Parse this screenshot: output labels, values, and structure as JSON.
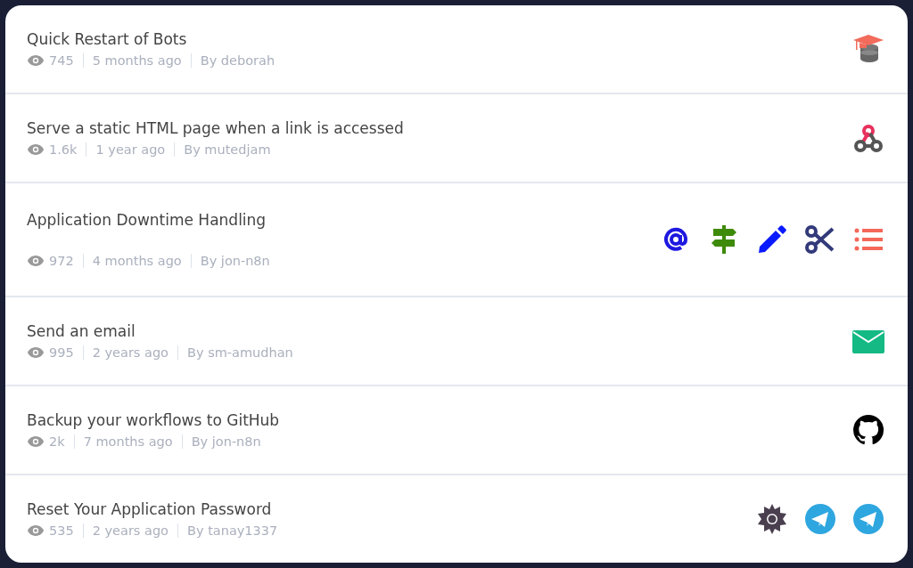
{
  "workflows": [
    {
      "title": "Quick Restart of Bots",
      "views": "745",
      "age": "5 months ago",
      "author": "By deborah",
      "icons": [
        {
          "kind": "school-database"
        }
      ]
    },
    {
      "title": "Serve a static HTML page when a link is accessed",
      "views": "1.6k",
      "age": "1 year ago",
      "author": "By mutedjam",
      "icons": [
        {
          "kind": "webhook"
        }
      ]
    },
    {
      "title": "Application Downtime Handling",
      "views": "972",
      "age": "4 months ago",
      "author": "By jon-n8n",
      "icons": [
        {
          "kind": "at"
        },
        {
          "kind": "signpost"
        },
        {
          "kind": "pencil"
        },
        {
          "kind": "scissors"
        },
        {
          "kind": "list"
        }
      ]
    },
    {
      "title": "Send an email",
      "views": "995",
      "age": "2 years ago",
      "author": "By sm-amudhan",
      "icons": [
        {
          "kind": "email"
        }
      ]
    },
    {
      "title": "Backup your workflows to GitHub",
      "views": "2k",
      "age": "7 months ago",
      "author": "By jon-n8n",
      "icons": [
        {
          "kind": "github"
        }
      ]
    },
    {
      "title": "Reset Your Application Password",
      "views": "535",
      "age": "2 years ago",
      "author": "By tanay1337",
      "icons": [
        {
          "kind": "gear"
        },
        {
          "kind": "telegram"
        },
        {
          "kind": "telegram"
        }
      ]
    }
  ]
}
